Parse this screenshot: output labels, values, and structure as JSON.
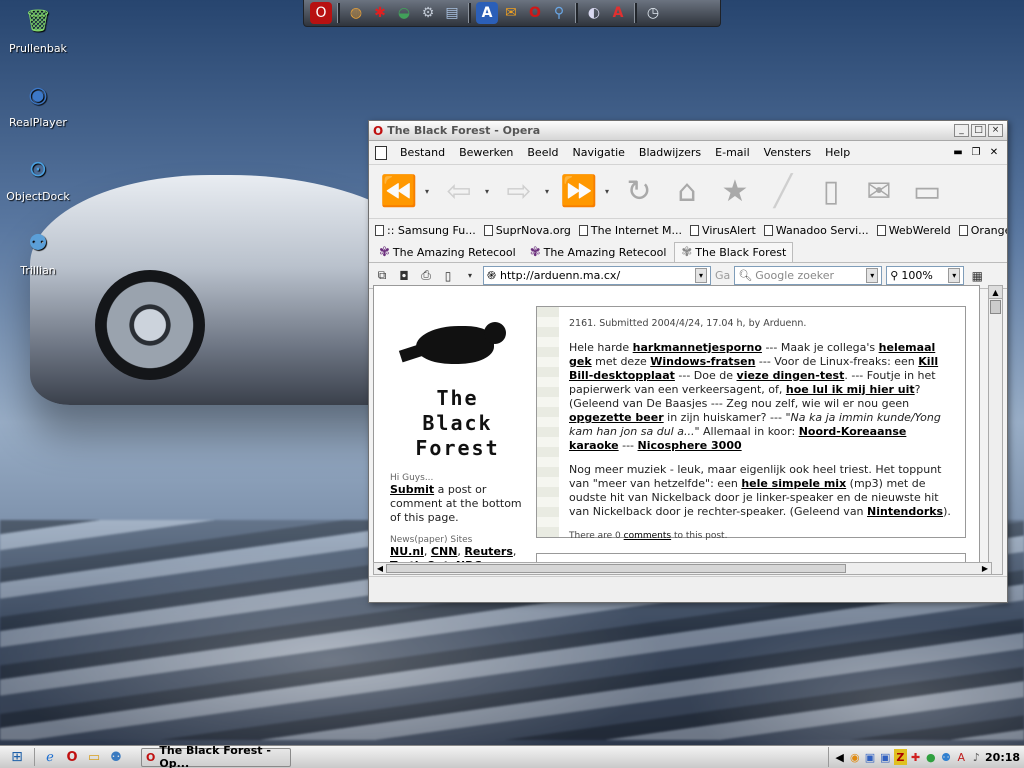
{
  "desktop": {
    "icons": [
      {
        "label": "Prullenbak",
        "glyph": "🗑"
      },
      {
        "label": "RealPlayer",
        "glyph": "◉"
      },
      {
        "label": "ObjectDock",
        "glyph": "⊙"
      },
      {
        "label": "Trillian",
        "glyph": "⚉"
      }
    ]
  },
  "dock": {
    "items": [
      "O",
      "◍",
      "✱",
      "◒",
      "⚙",
      "▤",
      "A",
      "✉",
      "O",
      "⚲",
      "◐",
      "A",
      "◷"
    ]
  },
  "window": {
    "title": "The Black Forest - Opera",
    "menu": [
      "Bestand",
      "Bewerken",
      "Beeld",
      "Navigatie",
      "Bladwijzers",
      "E-mail",
      "Vensters",
      "Help"
    ],
    "bookmarks": [
      ":: Samsung Fu...",
      "SuprNova.org",
      "The Internet M...",
      "VirusAlert",
      "Wanadoo Servi...",
      "WebWereld",
      "Orange"
    ],
    "tabs": [
      {
        "label": "The Amazing Retecool"
      },
      {
        "label": "The Amazing Retecool"
      },
      {
        "label": "The Black Forest"
      }
    ],
    "address": "http://arduenn.ma.cx/",
    "go_label": "Ga",
    "search_placeholder": "Google zoeker",
    "zoom": "100%"
  },
  "page": {
    "logo_lines": [
      "The",
      "Black",
      "Forest"
    ],
    "side_small_1": "Hi Guys...",
    "side_submit": "Submit",
    "side_text_1": " a post or comment at the bottom of this page.",
    "side_small_2": "News(paper) Sites",
    "side_links": [
      "NU.nl",
      "CNN",
      "Reuters",
      "Truth Out",
      "NRC"
    ],
    "post": {
      "meta": "2161. Submitted 2004/4/24, 17.04 h, by Arduenn.",
      "p1_parts": [
        "Hele harde ",
        "harkmannetjesporno",
        " --- Maak je collega's ",
        "helemaal gek",
        " met deze ",
        "Windows-fratsen",
        " --- Voor de Linux-freaks: een ",
        "Kill Bill-desktopplaat",
        " --- Doe de ",
        "vieze dingen-test",
        ". --- Foutje in het papierwerk van een verkeersagent, of, ",
        "hoe lul ik mij hier uit",
        "? (Geleend van De Baasjes --- Zeg nou zelf, wie wil er nou geen ",
        "opgezette beer",
        " in zijn huiskamer? --- ",
        "\"Na ka ja immin kunde/Yong kam han jon sa dul a...\"",
        " Allemaal in koor: ",
        "Noord-Koreaanse karaoke",
        " --- ",
        "Nicosphere 3000"
      ],
      "p2_parts": [
        "Nog meer muziek - leuk, maar eigenlijk ook heel triest. Het toppunt van \"meer van hetzelfde\": een ",
        "hele simpele mix",
        " (mp3) met de oudste hit van Nickelback door je linker-speaker en de nieuwste hit van Nickelback door je rechter-speaker. (Geleend van ",
        "Nintendorks",
        ")."
      ],
      "footer_pre": "There are 0 ",
      "footer_link": "comments",
      "footer_post": " to this post."
    }
  },
  "taskbar": {
    "task_label": "The Black Forest - Op...",
    "clock": "20:18"
  },
  "colors": {
    "link": "#000000",
    "tab_flower": "#6b2f7d",
    "title_text": "#555555"
  }
}
